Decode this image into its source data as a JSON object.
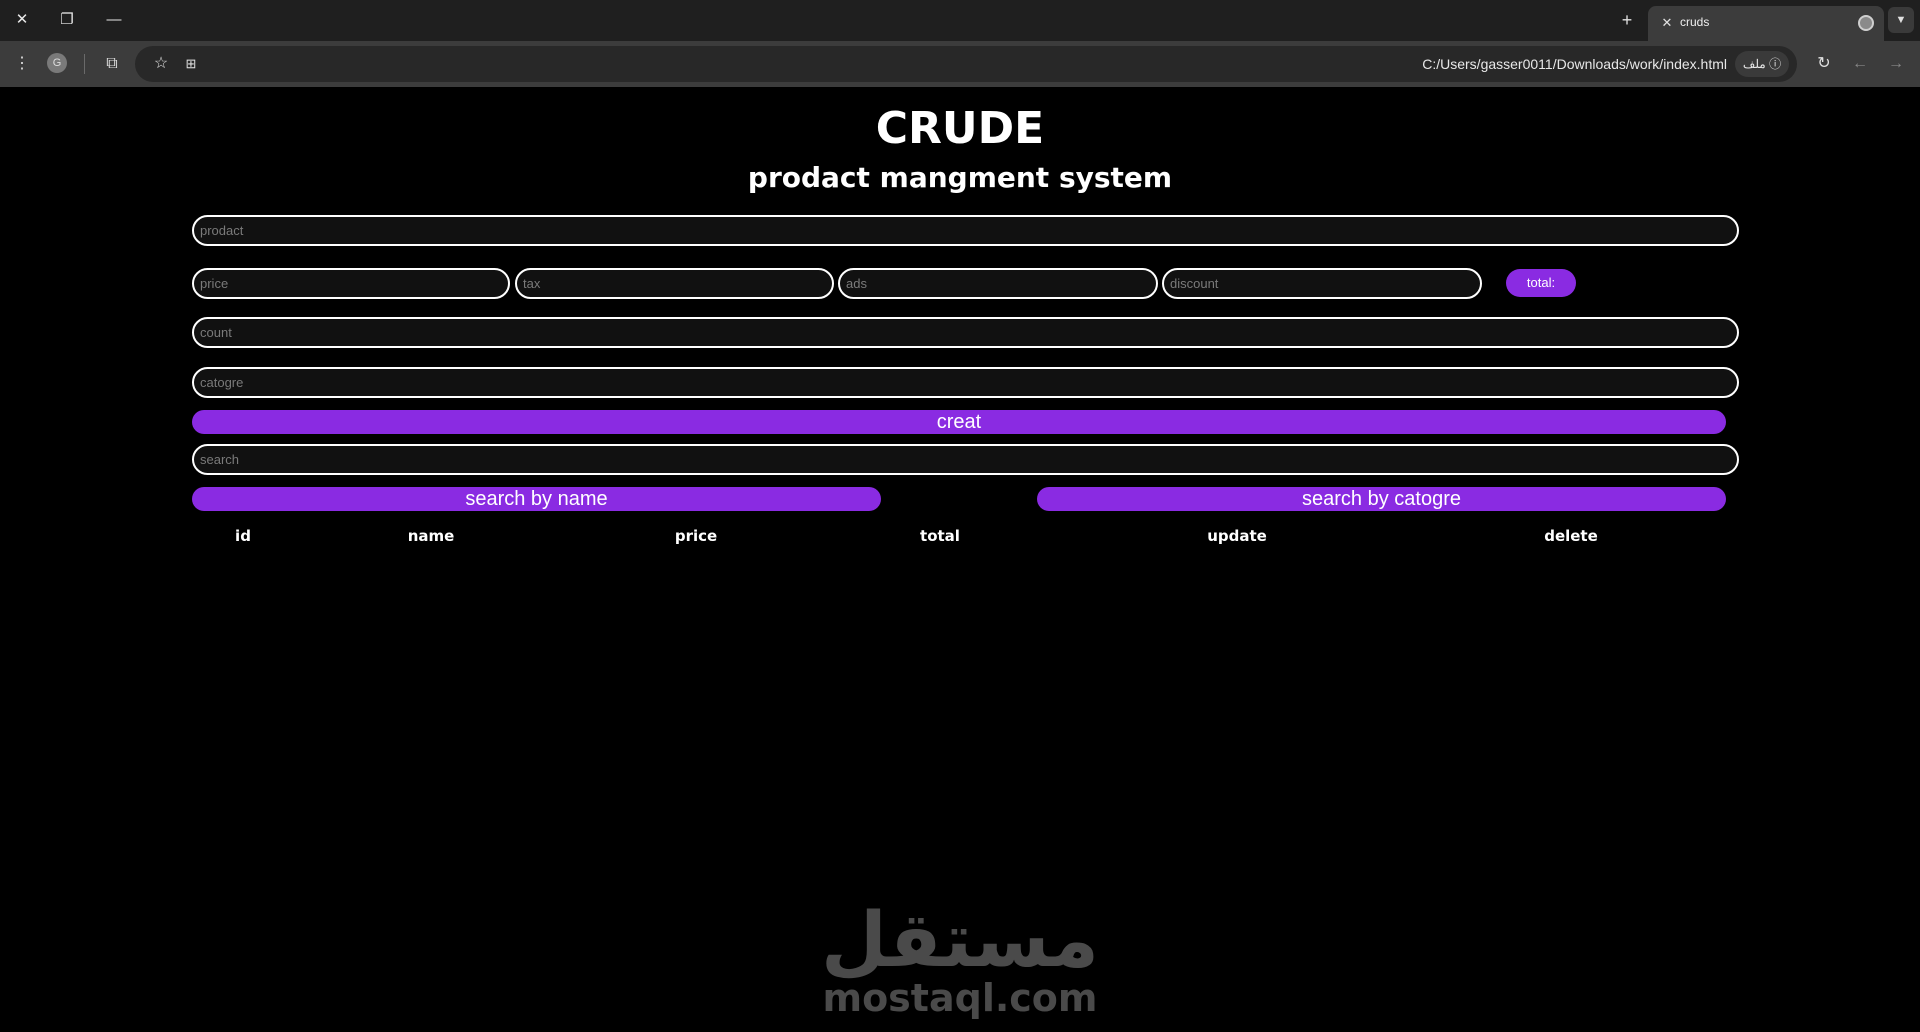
{
  "browser": {
    "tab_title": "cruds",
    "url": "C:/Users/gasser0011/Downloads/work/index.html",
    "site_chip": "ملف",
    "profile_initial": "G"
  },
  "page": {
    "title": "CRUDE",
    "subtitle": "prodact mangment system"
  },
  "form": {
    "product_placeholder": "prodact",
    "price_placeholder": "price",
    "tax_placeholder": "tax",
    "ads_placeholder": "ads",
    "discount_placeholder": "discount",
    "total_label": "total:",
    "count_placeholder": "count",
    "category_placeholder": "catogre",
    "create_label": "creat"
  },
  "search": {
    "placeholder": "search",
    "by_name_label": "search by name",
    "by_category_label": "search by catogre"
  },
  "table": {
    "headers": [
      "id",
      "name",
      "price",
      "total",
      "update",
      "delete"
    ]
  },
  "watermark": {
    "arabic": "مستقل",
    "latin": "mostaql.com"
  },
  "colors": {
    "accent": "#8a2be2",
    "background": "#000000"
  }
}
